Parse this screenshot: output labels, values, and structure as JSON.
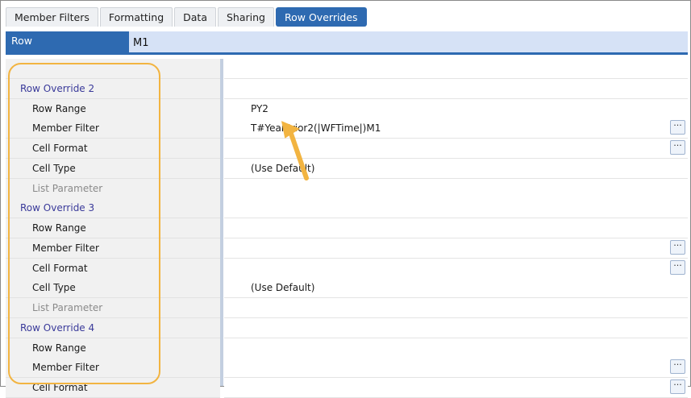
{
  "tabs": [
    {
      "label": "Member Filters",
      "active": false
    },
    {
      "label": "Formatting",
      "active": false
    },
    {
      "label": "Data",
      "active": false
    },
    {
      "label": "Sharing",
      "active": false
    },
    {
      "label": "Row Overrides",
      "active": true
    }
  ],
  "header": {
    "label": "Row",
    "value": "M1"
  },
  "rows": [
    {
      "kind": "blank"
    },
    {
      "kind": "group",
      "name": "Row Override 2",
      "value": ""
    },
    {
      "kind": "prop",
      "name": "Row Range",
      "value": "PY2",
      "button": false
    },
    {
      "kind": "prop",
      "name": "Member Filter",
      "value": "T#YearPrior2(|WFTime|)M1",
      "button": true
    },
    {
      "kind": "prop",
      "name": "Cell Format",
      "value": "",
      "button": true
    },
    {
      "kind": "prop",
      "name": "Cell Type",
      "value": "(Use Default)",
      "button": false
    },
    {
      "kind": "prop",
      "name": "List Parameter",
      "value": "",
      "button": false,
      "dim": true
    },
    {
      "kind": "group",
      "name": "Row Override 3",
      "value": ""
    },
    {
      "kind": "prop",
      "name": "Row Range",
      "value": "",
      "button": false
    },
    {
      "kind": "prop",
      "name": "Member Filter",
      "value": "",
      "button": true
    },
    {
      "kind": "prop",
      "name": "Cell Format",
      "value": "",
      "button": true
    },
    {
      "kind": "prop",
      "name": "Cell Type",
      "value": "(Use Default)",
      "button": false
    },
    {
      "kind": "prop",
      "name": "List Parameter",
      "value": "",
      "button": false,
      "dim": true
    },
    {
      "kind": "group",
      "name": "Row Override 4",
      "value": ""
    },
    {
      "kind": "prop",
      "name": "Row Range",
      "value": "",
      "button": false
    },
    {
      "kind": "prop",
      "name": "Member Filter",
      "value": "",
      "button": true
    },
    {
      "kind": "prop",
      "name": "Cell Format",
      "value": "",
      "button": true
    }
  ],
  "ellipsis_label": "···",
  "colors": {
    "accent": "#2e6ab1",
    "highlight": "#f2b441"
  },
  "icons": {
    "ellipsis": "ellipsis-button-icon",
    "arrow": "annotation-arrow"
  }
}
